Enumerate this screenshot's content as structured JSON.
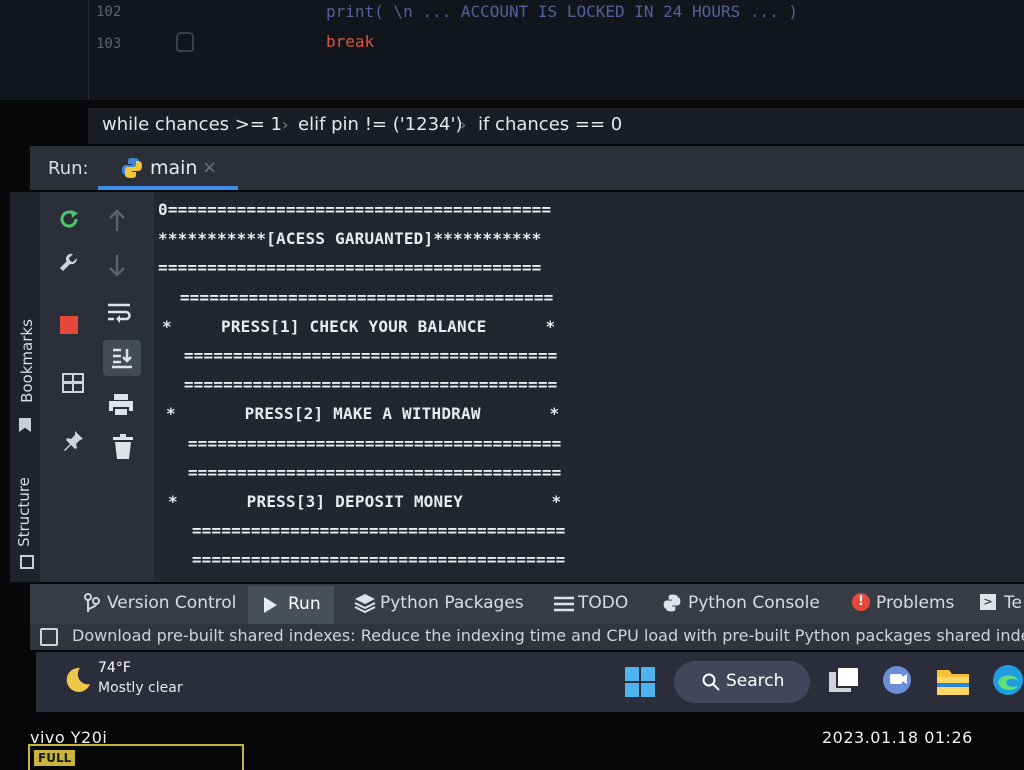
{
  "editor": {
    "line_numbers": [
      "102",
      "103"
    ],
    "code_lines": [
      "print( \\n ... ACCOUNT IS LOCKED IN 24 HOURS ... )",
      "break"
    ]
  },
  "breadcrumb": [
    "while chances >= 1",
    "elif pin != ('1234')",
    "if chances == 0"
  ],
  "run_panel": {
    "label": "Run:",
    "tab_name": "main",
    "tab_close": "×"
  },
  "side_labels": {
    "bookmarks": "Bookmarks",
    "structure": "Structure"
  },
  "console_lines": [
    "0=======================================",
    "***********[ACESS GARUANTED]***********",
    "=======================================",
    " ======================================",
    "*     PRESS[1] CHECK YOUR BALANCE      *",
    " ======================================",
    " ======================================",
    "*       PRESS[2] MAKE A WITHDRAW       *",
    " ======================================",
    " ======================================",
    "*       PRESS[3] DEPOSIT MONEY         *",
    " ======================================",
    " ======================================"
  ],
  "bottom_tabs": [
    "Version Control",
    "Run",
    "Python Packages",
    "TODO",
    "Python Console",
    "Problems",
    "Te"
  ],
  "status_message": "Download pre-built shared indexes: Reduce the indexing time and CPU load with pre-built Python packages shared index",
  "taskbar": {
    "temperature": "74°F",
    "weather": "Mostly clear",
    "search_label": "Search"
  },
  "photo": {
    "device": "vivo Y20i",
    "timestamp": "2023.01.18 01:26",
    "badge": "FULL"
  },
  "colors": {
    "accent_blue": "#3d8ee6",
    "console_bg": "#23262c",
    "stop_red": "#e5483b",
    "rerun_green": "#4cc36d"
  }
}
